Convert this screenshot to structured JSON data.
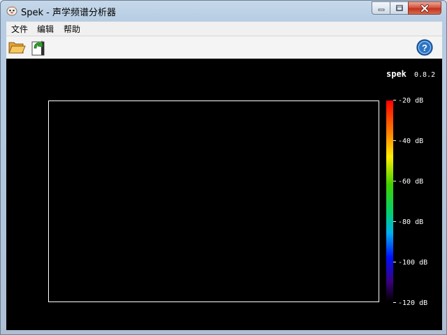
{
  "window": {
    "title": "Spek - 声学频谱分析器"
  },
  "menu": {
    "items": [
      "文件",
      "编辑",
      "帮助"
    ]
  },
  "toolbar": {
    "open_icon": "folder-open-icon",
    "save_icon": "save-arrow-icon",
    "help_icon": "help-icon"
  },
  "spectrum": {
    "app_name": "spek",
    "version": "0.8.2",
    "scale_labels": [
      "-20 dB",
      "-40 dB",
      "-60 dB",
      "-80 dB",
      "-100 dB",
      "-120 dB"
    ],
    "colors": {
      "background": "#000000",
      "frame": "#ffffff",
      "scale_top": "#ff0000",
      "scale_bottom": "#000000"
    }
  }
}
